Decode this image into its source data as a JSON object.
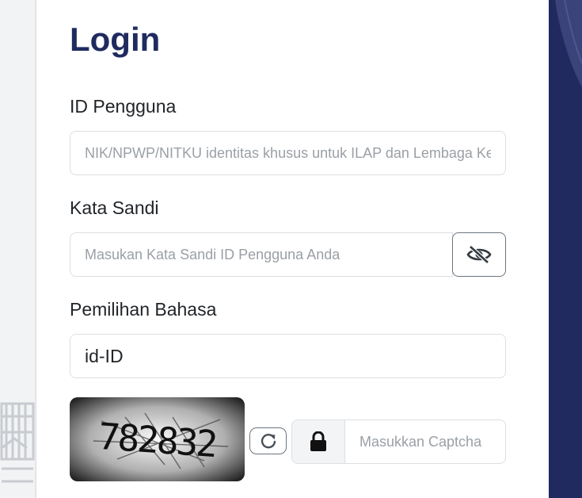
{
  "login": {
    "title": "Login",
    "user_id": {
      "label": "ID Pengguna",
      "placeholder": "NIK/NPWP/NITKU identitas khusus untuk ILAP dan Lembaga Keuangan",
      "value": ""
    },
    "password": {
      "label": "Kata Sandi",
      "placeholder": "Masukan Kata Sandi ID Pengguna Anda",
      "value": "",
      "toggle_icon": "eye-slash-icon"
    },
    "language": {
      "label": "Pemilihan Bahasa",
      "selected": "id-ID"
    },
    "captcha": {
      "image_text": "782832",
      "refresh_icon": "refresh-icon",
      "lock_icon": "lock-icon",
      "placeholder": "Masukkan Captcha",
      "value": ""
    }
  },
  "colors": {
    "title": "#1f2b5f",
    "side_panel": "#202a5e"
  }
}
